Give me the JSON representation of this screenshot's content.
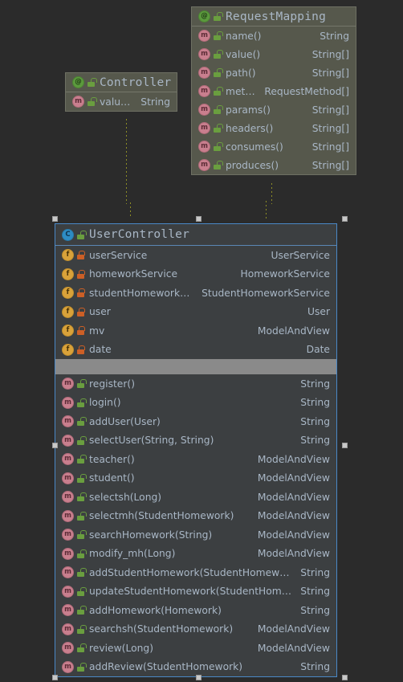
{
  "canvas": {
    "background": "#2b2b2b",
    "connector_color": "#8e8e26",
    "selection_color": "#4a88c7",
    "separator_color": "#8a8a8a"
  },
  "nodes": [
    {
      "id": "controller",
      "kind": "annotation",
      "icon": "annotation-icon",
      "visibility": "public",
      "title": "Controller",
      "members": [
        {
          "icon": "method-icon",
          "visibility": "public",
          "name": "value()",
          "type": "String"
        }
      ]
    },
    {
      "id": "request-mapping",
      "kind": "annotation",
      "icon": "annotation-icon",
      "visibility": "public",
      "title": "RequestMapping",
      "members": [
        {
          "icon": "method-icon",
          "visibility": "public",
          "name": "name()",
          "type": "String"
        },
        {
          "icon": "method-icon",
          "visibility": "public",
          "name": "value()",
          "type": "String[]"
        },
        {
          "icon": "method-icon",
          "visibility": "public",
          "name": "path()",
          "type": "String[]"
        },
        {
          "icon": "method-icon",
          "visibility": "public",
          "name": "method()",
          "type": "RequestMethod[]"
        },
        {
          "icon": "method-icon",
          "visibility": "public",
          "name": "params()",
          "type": "String[]"
        },
        {
          "icon": "method-icon",
          "visibility": "public",
          "name": "headers()",
          "type": "String[]"
        },
        {
          "icon": "method-icon",
          "visibility": "public",
          "name": "consumes()",
          "type": "String[]"
        },
        {
          "icon": "method-icon",
          "visibility": "public",
          "name": "produces()",
          "type": "String[]"
        }
      ]
    },
    {
      "id": "user-controller",
      "kind": "class",
      "icon": "class-icon",
      "visibility": "public",
      "selected": true,
      "title": "UserController",
      "fields": [
        {
          "icon": "field-icon",
          "visibility": "private",
          "name": "userService",
          "type": "UserService"
        },
        {
          "icon": "field-icon",
          "visibility": "private",
          "name": "homeworkService",
          "type": "HomeworkService"
        },
        {
          "icon": "field-icon",
          "visibility": "private",
          "name": "studentHomeworkService",
          "type": "StudentHomeworkService"
        },
        {
          "icon": "field-icon",
          "visibility": "private",
          "name": "user",
          "type": "User"
        },
        {
          "icon": "field-icon",
          "visibility": "private",
          "name": "mv",
          "type": "ModelAndView"
        },
        {
          "icon": "field-icon",
          "visibility": "private",
          "name": "date",
          "type": "Date"
        }
      ],
      "methods": [
        {
          "icon": "method-icon",
          "visibility": "public",
          "name": "register()",
          "type": "String"
        },
        {
          "icon": "method-icon",
          "visibility": "public",
          "name": "login()",
          "type": "String"
        },
        {
          "icon": "method-icon",
          "visibility": "public",
          "name": "addUser(User)",
          "type": "String"
        },
        {
          "icon": "method-icon",
          "visibility": "public",
          "name": "selectUser(String, String)",
          "type": "String"
        },
        {
          "icon": "method-icon",
          "visibility": "public",
          "name": "teacher()",
          "type": "ModelAndView"
        },
        {
          "icon": "method-icon",
          "visibility": "public",
          "name": "student()",
          "type": "ModelAndView"
        },
        {
          "icon": "method-icon",
          "visibility": "public",
          "name": "selectsh(Long)",
          "type": "ModelAndView"
        },
        {
          "icon": "method-icon",
          "visibility": "public",
          "name": "selectmh(StudentHomework)",
          "type": "ModelAndView"
        },
        {
          "icon": "method-icon",
          "visibility": "public",
          "name": "searchHomework(String)",
          "type": "ModelAndView"
        },
        {
          "icon": "method-icon",
          "visibility": "public",
          "name": "modify_mh(Long)",
          "type": "ModelAndView"
        },
        {
          "icon": "method-icon",
          "visibility": "public",
          "name": "addStudentHomework(StudentHomework)",
          "type": "String"
        },
        {
          "icon": "method-icon",
          "visibility": "public",
          "name": "updateStudentHomework(StudentHomework)",
          "type": "String"
        },
        {
          "icon": "method-icon",
          "visibility": "public",
          "name": "addHomework(Homework)",
          "type": "String"
        },
        {
          "icon": "method-icon",
          "visibility": "public",
          "name": "searchsh(StudentHomework)",
          "type": "ModelAndView"
        },
        {
          "icon": "method-icon",
          "visibility": "public",
          "name": "review(Long)",
          "type": "ModelAndView"
        },
        {
          "icon": "method-icon",
          "visibility": "public",
          "name": "addReview(StudentHomework)",
          "type": "String"
        }
      ]
    }
  ],
  "icon_glyphs": {
    "annotation-icon": "@",
    "method-icon": "m",
    "field-icon": "f",
    "class-icon": "C"
  }
}
